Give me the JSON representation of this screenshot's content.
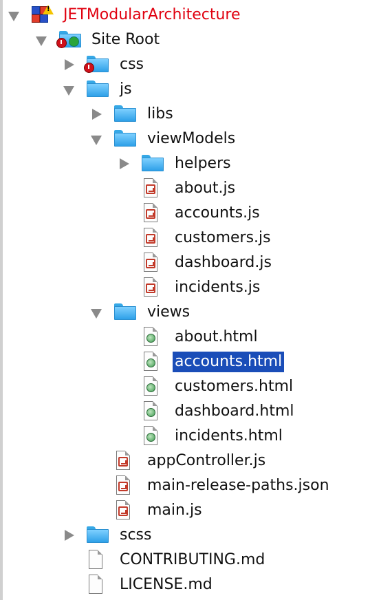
{
  "tree": {
    "project": {
      "label": "JETModularArchitecture",
      "icon": "project-warning-icon",
      "color": "#e0000f"
    },
    "site_root": {
      "label": "Site Root",
      "icon": "site-root-folder-icon"
    },
    "css": {
      "label": "css",
      "icon": "folder-error-icon"
    },
    "js": {
      "label": "js",
      "icon": "folder-icon"
    },
    "libs": {
      "label": "libs",
      "icon": "folder-icon"
    },
    "viewModels": {
      "label": "viewModels",
      "icon": "folder-icon"
    },
    "helpers": {
      "label": "helpers",
      "icon": "folder-icon"
    },
    "viewModel_files": [
      {
        "label": "about.js",
        "icon": "js-file-icon"
      },
      {
        "label": "accounts.js",
        "icon": "js-file-icon"
      },
      {
        "label": "customers.js",
        "icon": "js-file-icon"
      },
      {
        "label": "dashboard.js",
        "icon": "js-file-icon"
      },
      {
        "label": "incidents.js",
        "icon": "js-file-icon"
      }
    ],
    "views": {
      "label": "views",
      "icon": "folder-icon"
    },
    "view_files": [
      {
        "label": "about.html",
        "icon": "html-file-icon"
      },
      {
        "label": "accounts.html",
        "icon": "html-file-icon",
        "selected": true
      },
      {
        "label": "customers.html",
        "icon": "html-file-icon"
      },
      {
        "label": "dashboard.html",
        "icon": "html-file-icon"
      },
      {
        "label": "incidents.html",
        "icon": "html-file-icon"
      }
    ],
    "js_files": [
      {
        "label": "appController.js",
        "icon": "js-file-icon"
      },
      {
        "label": "main-release-paths.json",
        "icon": "js-file-icon"
      },
      {
        "label": "main.js",
        "icon": "js-file-icon"
      }
    ],
    "scss": {
      "label": "scss",
      "icon": "folder-icon"
    },
    "root_files": [
      {
        "label": "CONTRIBUTING.md",
        "icon": "text-file-icon"
      },
      {
        "label": "LICENSE.md",
        "icon": "text-file-icon"
      }
    ]
  },
  "colors": {
    "selection": "#1a4db8",
    "folder": "#36a8e6",
    "arrow": "#8a8a8a"
  }
}
